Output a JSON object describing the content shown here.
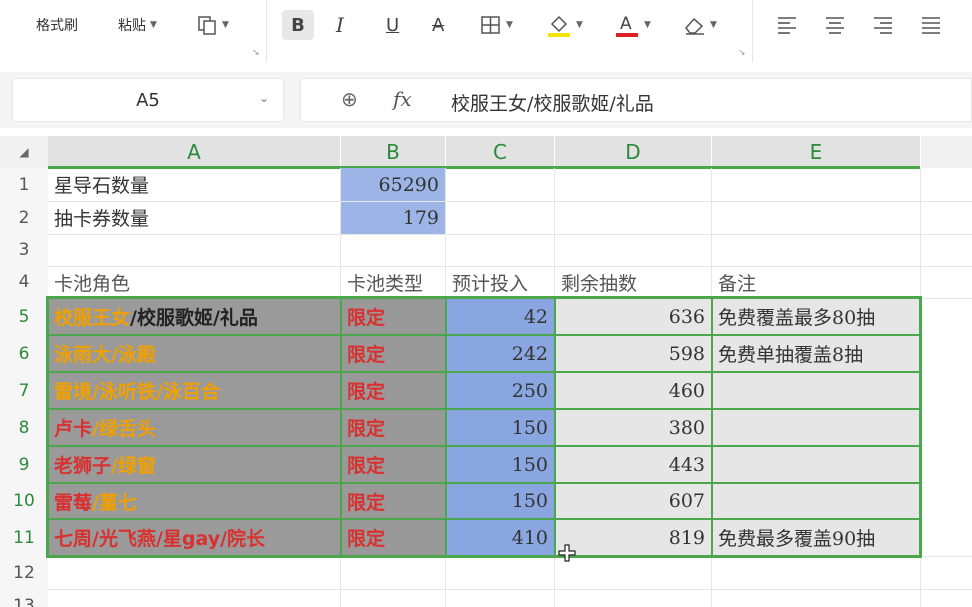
{
  "toolbar": {
    "format_painter": "格式刷",
    "paste": "粘贴",
    "bold": "B",
    "italic": "I",
    "underline": "U",
    "strike": "A",
    "colors": {
      "highlight": "#f5e400",
      "font": "#e02020"
    }
  },
  "formula_bar": {
    "name_box": "A5",
    "fx": "fx",
    "value": "校服王女/校服歌姬/礼品"
  },
  "columns": [
    "A",
    "B",
    "C",
    "D",
    "E"
  ],
  "rows": [
    "1",
    "2",
    "3",
    "4",
    "5",
    "6",
    "7",
    "8",
    "9",
    "10",
    "11",
    "12",
    "13"
  ],
  "sheet": {
    "r1": {
      "a": "星导石数量",
      "b": "65290"
    },
    "r2": {
      "a": "抽卡券数量",
      "b": "179"
    },
    "headers": {
      "a": "卡池角色",
      "b": "卡池类型",
      "c": "预计投入",
      "d": "剩余抽数",
      "e": "备注"
    },
    "data": [
      {
        "a1": "校服王女",
        "a2": "/校服歌姬/礼品",
        "b": "限定",
        "c": "42",
        "d": "636",
        "e": "免费覆盖最多80抽"
      },
      {
        "a1": "泳雨大/泳殿",
        "a2": "",
        "b": "限定",
        "c": "242",
        "d": "598",
        "e": "免费单抽覆盖8抽"
      },
      {
        "a1": "雷境/泳听铁/泳百合",
        "a2": "",
        "b": "限定",
        "c": "250",
        "d": "460",
        "e": ""
      },
      {
        "a1": "卢卡",
        "a2": "/绿舌头",
        "b": "限定",
        "c": "150",
        "d": "380",
        "e": ""
      },
      {
        "a1": "老狮子",
        "a2": "/绿窗",
        "b": "限定",
        "c": "150",
        "d": "443",
        "e": ""
      },
      {
        "a1": "雷莓",
        "a2": "/菫七",
        "b": "限定",
        "c": "150",
        "d": "607",
        "e": ""
      },
      {
        "a1": "七周/光飞燕/星gay/院长",
        "a2": "",
        "b": "限定",
        "c": "410",
        "d": "819",
        "e": "免费最多覆盖90抽"
      }
    ]
  }
}
